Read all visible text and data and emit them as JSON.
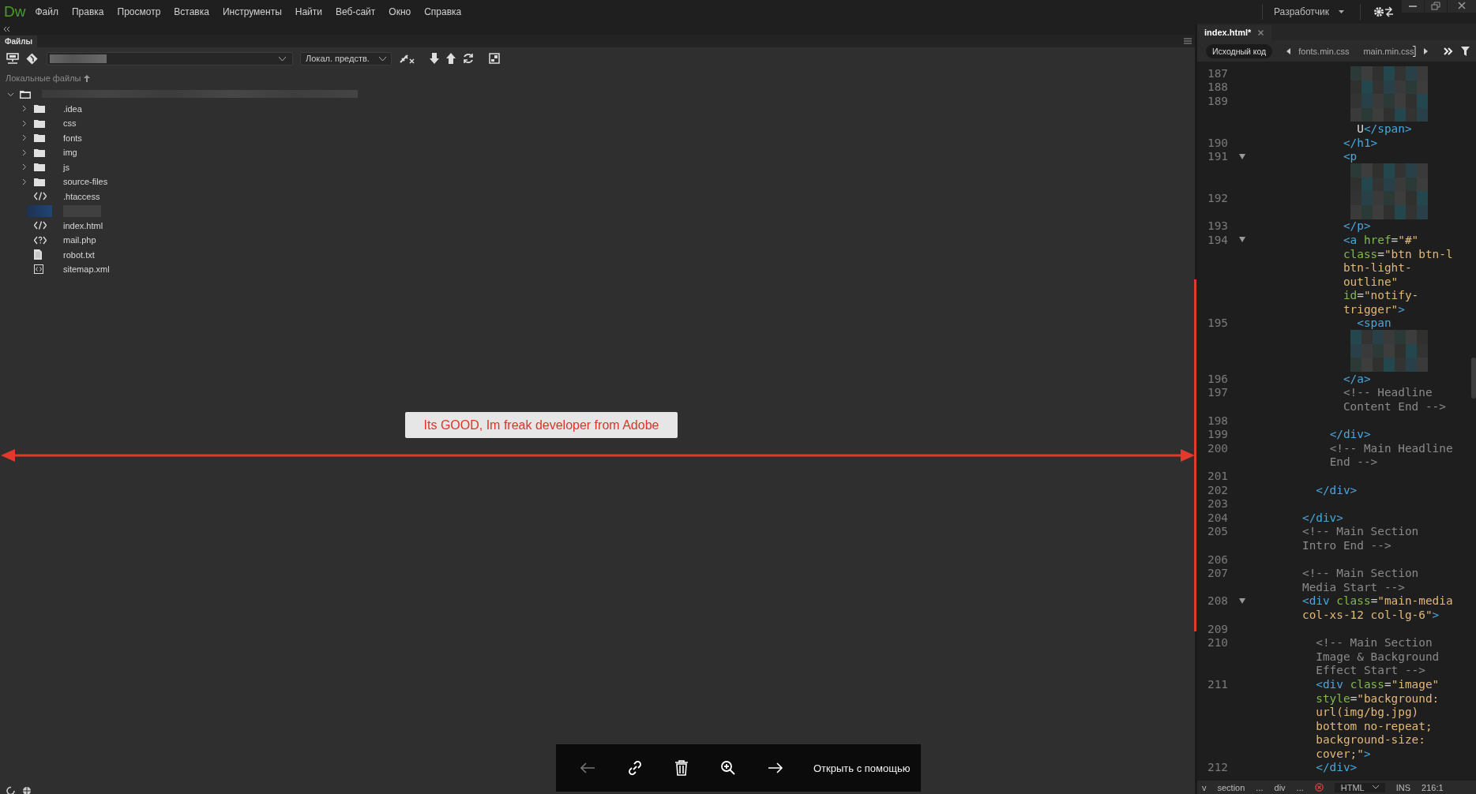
{
  "app": {
    "logo": "Dw",
    "menu": [
      "Файл",
      "Правка",
      "Просмотр",
      "Вставка",
      "Инструменты",
      "Найти",
      "Веб-сайт",
      "Окно",
      "Справка"
    ],
    "workspace": "Разработчик"
  },
  "files_panel": {
    "tab": "Файлы",
    "view": "Локал. предств.",
    "header": "Локальные файлы",
    "tree": {
      "expanded": true,
      "children": [
        {
          "name": ".idea",
          "kind": "folder",
          "expanded": false
        },
        {
          "name": "css",
          "kind": "folder",
          "expanded": false
        },
        {
          "name": "fonts",
          "kind": "folder",
          "expanded": false
        },
        {
          "name": "img",
          "kind": "folder",
          "expanded": false
        },
        {
          "name": "js",
          "kind": "folder",
          "expanded": false
        },
        {
          "name": "source-files",
          "kind": "folder",
          "expanded": false
        },
        {
          "name": ".htaccess",
          "kind": "code"
        },
        {
          "kind": "redacted"
        },
        {
          "name": "index.html",
          "kind": "code"
        },
        {
          "name": "mail.php",
          "kind": "php"
        },
        {
          "name": "robot.txt",
          "kind": "text"
        },
        {
          "name": "sitemap.xml",
          "kind": "xml"
        }
      ]
    }
  },
  "editor": {
    "tabs": [
      {
        "label": "index.html*",
        "selected": true
      }
    ],
    "source_button": "Исходный код",
    "related_files": [
      "fonts.min.css",
      "main.min.css"
    ],
    "lines": [
      {
        "n": "187",
        "kind": "redacted"
      },
      {
        "n": "188",
        "kind": "redacted"
      },
      {
        "n": "189",
        "kind": "redacted"
      },
      {
        "kind": "redacted"
      },
      {
        "kind": "code",
        "tokens": [
          {
            "kind": "text",
            "text": "              U"
          },
          {
            "kind": "tag",
            "text": "</span>"
          }
        ]
      },
      {
        "n": "190",
        "kind": "code",
        "tokens": [
          {
            "kind": "tag",
            "text": "            </h1>"
          }
        ]
      },
      {
        "n": "191",
        "kind": "code",
        "fold": true,
        "tokens": [
          {
            "kind": "tag",
            "text": "            <p"
          }
        ]
      },
      {
        "kind": "redacted"
      },
      {
        "kind": "redacted"
      },
      {
        "n": "192",
        "kind": "redacted"
      },
      {
        "kind": "redacted"
      },
      {
        "n": "193",
        "kind": "code",
        "tokens": [
          {
            "kind": "tag",
            "text": "            </p>"
          }
        ]
      },
      {
        "n": "194",
        "kind": "code",
        "fold": true,
        "tokens": [
          {
            "kind": "tag",
            "text": "            <a "
          },
          {
            "kind": "attr",
            "text": "href"
          },
          {
            "kind": "punct",
            "text": "="
          },
          {
            "kind": "string",
            "text": "\"#\""
          }
        ]
      },
      {
        "kind": "code",
        "tokens": [
          {
            "kind": "attr",
            "text": "            class"
          },
          {
            "kind": "punct",
            "text": "="
          },
          {
            "kind": "string",
            "text": "\"btn btn-l"
          }
        ]
      },
      {
        "kind": "code",
        "tokens": [
          {
            "kind": "string",
            "text": "            btn-light-"
          }
        ]
      },
      {
        "kind": "code",
        "tokens": [
          {
            "kind": "string",
            "text": "            outline\""
          }
        ]
      },
      {
        "kind": "code",
        "tokens": [
          {
            "kind": "attr",
            "text": "            id"
          },
          {
            "kind": "punct",
            "text": "="
          },
          {
            "kind": "string",
            "text": "\"notify-"
          }
        ]
      },
      {
        "kind": "code",
        "tokens": [
          {
            "kind": "string",
            "text": "            trigger\""
          },
          {
            "kind": "tag",
            "text": ">"
          }
        ]
      },
      {
        "n": "195",
        "kind": "code",
        "tokens": [
          {
            "kind": "tag",
            "text": "              <span"
          }
        ]
      },
      {
        "kind": "redacted"
      },
      {
        "kind": "redacted"
      },
      {
        "kind": "redacted"
      },
      {
        "n": "196",
        "kind": "code",
        "tokens": [
          {
            "kind": "tag",
            "text": "            </a>"
          }
        ]
      },
      {
        "n": "197",
        "kind": "code",
        "tokens": [
          {
            "kind": "comment",
            "text": "            <!-- Headline"
          }
        ]
      },
      {
        "kind": "code",
        "tokens": [
          {
            "kind": "comment",
            "text": "            Content End -->"
          }
        ]
      },
      {
        "n": "198",
        "kind": "code"
      },
      {
        "n": "199",
        "kind": "code",
        "tokens": [
          {
            "kind": "tag",
            "text": "          </div>"
          }
        ]
      },
      {
        "n": "200",
        "kind": "code",
        "tokens": [
          {
            "kind": "comment",
            "text": "          <!-- Main Headline"
          }
        ]
      },
      {
        "kind": "code",
        "tokens": [
          {
            "kind": "comment",
            "text": "          End -->"
          }
        ]
      },
      {
        "n": "201",
        "kind": "code"
      },
      {
        "n": "202",
        "kind": "code",
        "tokens": [
          {
            "kind": "tag",
            "text": "        </div>"
          }
        ]
      },
      {
        "n": "203",
        "kind": "code"
      },
      {
        "n": "204",
        "kind": "code",
        "tokens": [
          {
            "kind": "tag",
            "text": "      </div>"
          }
        ]
      },
      {
        "n": "205",
        "kind": "code",
        "tokens": [
          {
            "kind": "comment",
            "text": "      <!-- Main Section"
          }
        ]
      },
      {
        "kind": "code",
        "tokens": [
          {
            "kind": "comment",
            "text": "      Intro End -->"
          }
        ]
      },
      {
        "n": "206",
        "kind": "code"
      },
      {
        "n": "207",
        "kind": "code",
        "tokens": [
          {
            "kind": "comment",
            "text": "      <!-- Main Section"
          }
        ]
      },
      {
        "kind": "code",
        "tokens": [
          {
            "kind": "comment",
            "text": "      Media Start -->"
          }
        ]
      },
      {
        "n": "208",
        "kind": "code",
        "fold": true,
        "tokens": [
          {
            "kind": "tag",
            "text": "      <div "
          },
          {
            "kind": "attr",
            "text": "class"
          },
          {
            "kind": "punct",
            "text": "="
          },
          {
            "kind": "string",
            "text": "\"main-media"
          }
        ]
      },
      {
        "kind": "code",
        "tokens": [
          {
            "kind": "string",
            "text": "      col-xs-12 col-lg-6\""
          },
          {
            "kind": "tag",
            "text": ">"
          }
        ]
      },
      {
        "n": "209",
        "kind": "code"
      },
      {
        "n": "210",
        "kind": "code",
        "tokens": [
          {
            "kind": "comment",
            "text": "        <!-- Main Section"
          }
        ]
      },
      {
        "kind": "code",
        "tokens": [
          {
            "kind": "comment",
            "text": "        Image & Background"
          }
        ]
      },
      {
        "kind": "code",
        "tokens": [
          {
            "kind": "comment",
            "text": "        Effect Start -->"
          }
        ]
      },
      {
        "n": "211",
        "kind": "code",
        "tokens": [
          {
            "kind": "tag",
            "text": "        <div "
          },
          {
            "kind": "attr",
            "text": "class"
          },
          {
            "kind": "punct",
            "text": "="
          },
          {
            "kind": "string",
            "text": "\"image\""
          }
        ]
      },
      {
        "kind": "code",
        "tokens": [
          {
            "kind": "attr",
            "text": "        style"
          },
          {
            "kind": "punct",
            "text": "="
          },
          {
            "kind": "string",
            "text": "\"background:"
          }
        ]
      },
      {
        "kind": "code",
        "tokens": [
          {
            "kind": "string",
            "text": "        url(img/bg.jpg)"
          }
        ]
      },
      {
        "kind": "code",
        "tokens": [
          {
            "kind": "string",
            "text": "        bottom no-repeat;"
          }
        ]
      },
      {
        "kind": "code",
        "tokens": [
          {
            "kind": "string",
            "text": "        background-size:"
          }
        ]
      },
      {
        "kind": "code",
        "tokens": [
          {
            "kind": "string",
            "text": "        cover;\""
          },
          {
            "kind": "tag",
            "text": ">"
          }
        ]
      },
      {
        "n": "212",
        "kind": "code",
        "tokens": [
          {
            "kind": "tag",
            "text": "        </div>"
          }
        ]
      }
    ],
    "status_bar": {
      "breadcrumbs": [
        "v",
        "section",
        "...",
        "div",
        "..."
      ],
      "language": "HTML",
      "mode": "INS",
      "position": "216:1"
    }
  },
  "annotation": {
    "text": "Its GOOD, Im freak developer from Adobe"
  },
  "viewer_toolbar": {
    "buttons": [
      {
        "kind": "back",
        "disabled": true
      },
      {
        "kind": "link",
        "disabled": false
      },
      {
        "kind": "delete",
        "disabled": false
      },
      {
        "kind": "zoom",
        "disabled": false
      },
      {
        "kind": "forward",
        "disabled": false
      }
    ],
    "open_with": "Открыть с помощью"
  }
}
